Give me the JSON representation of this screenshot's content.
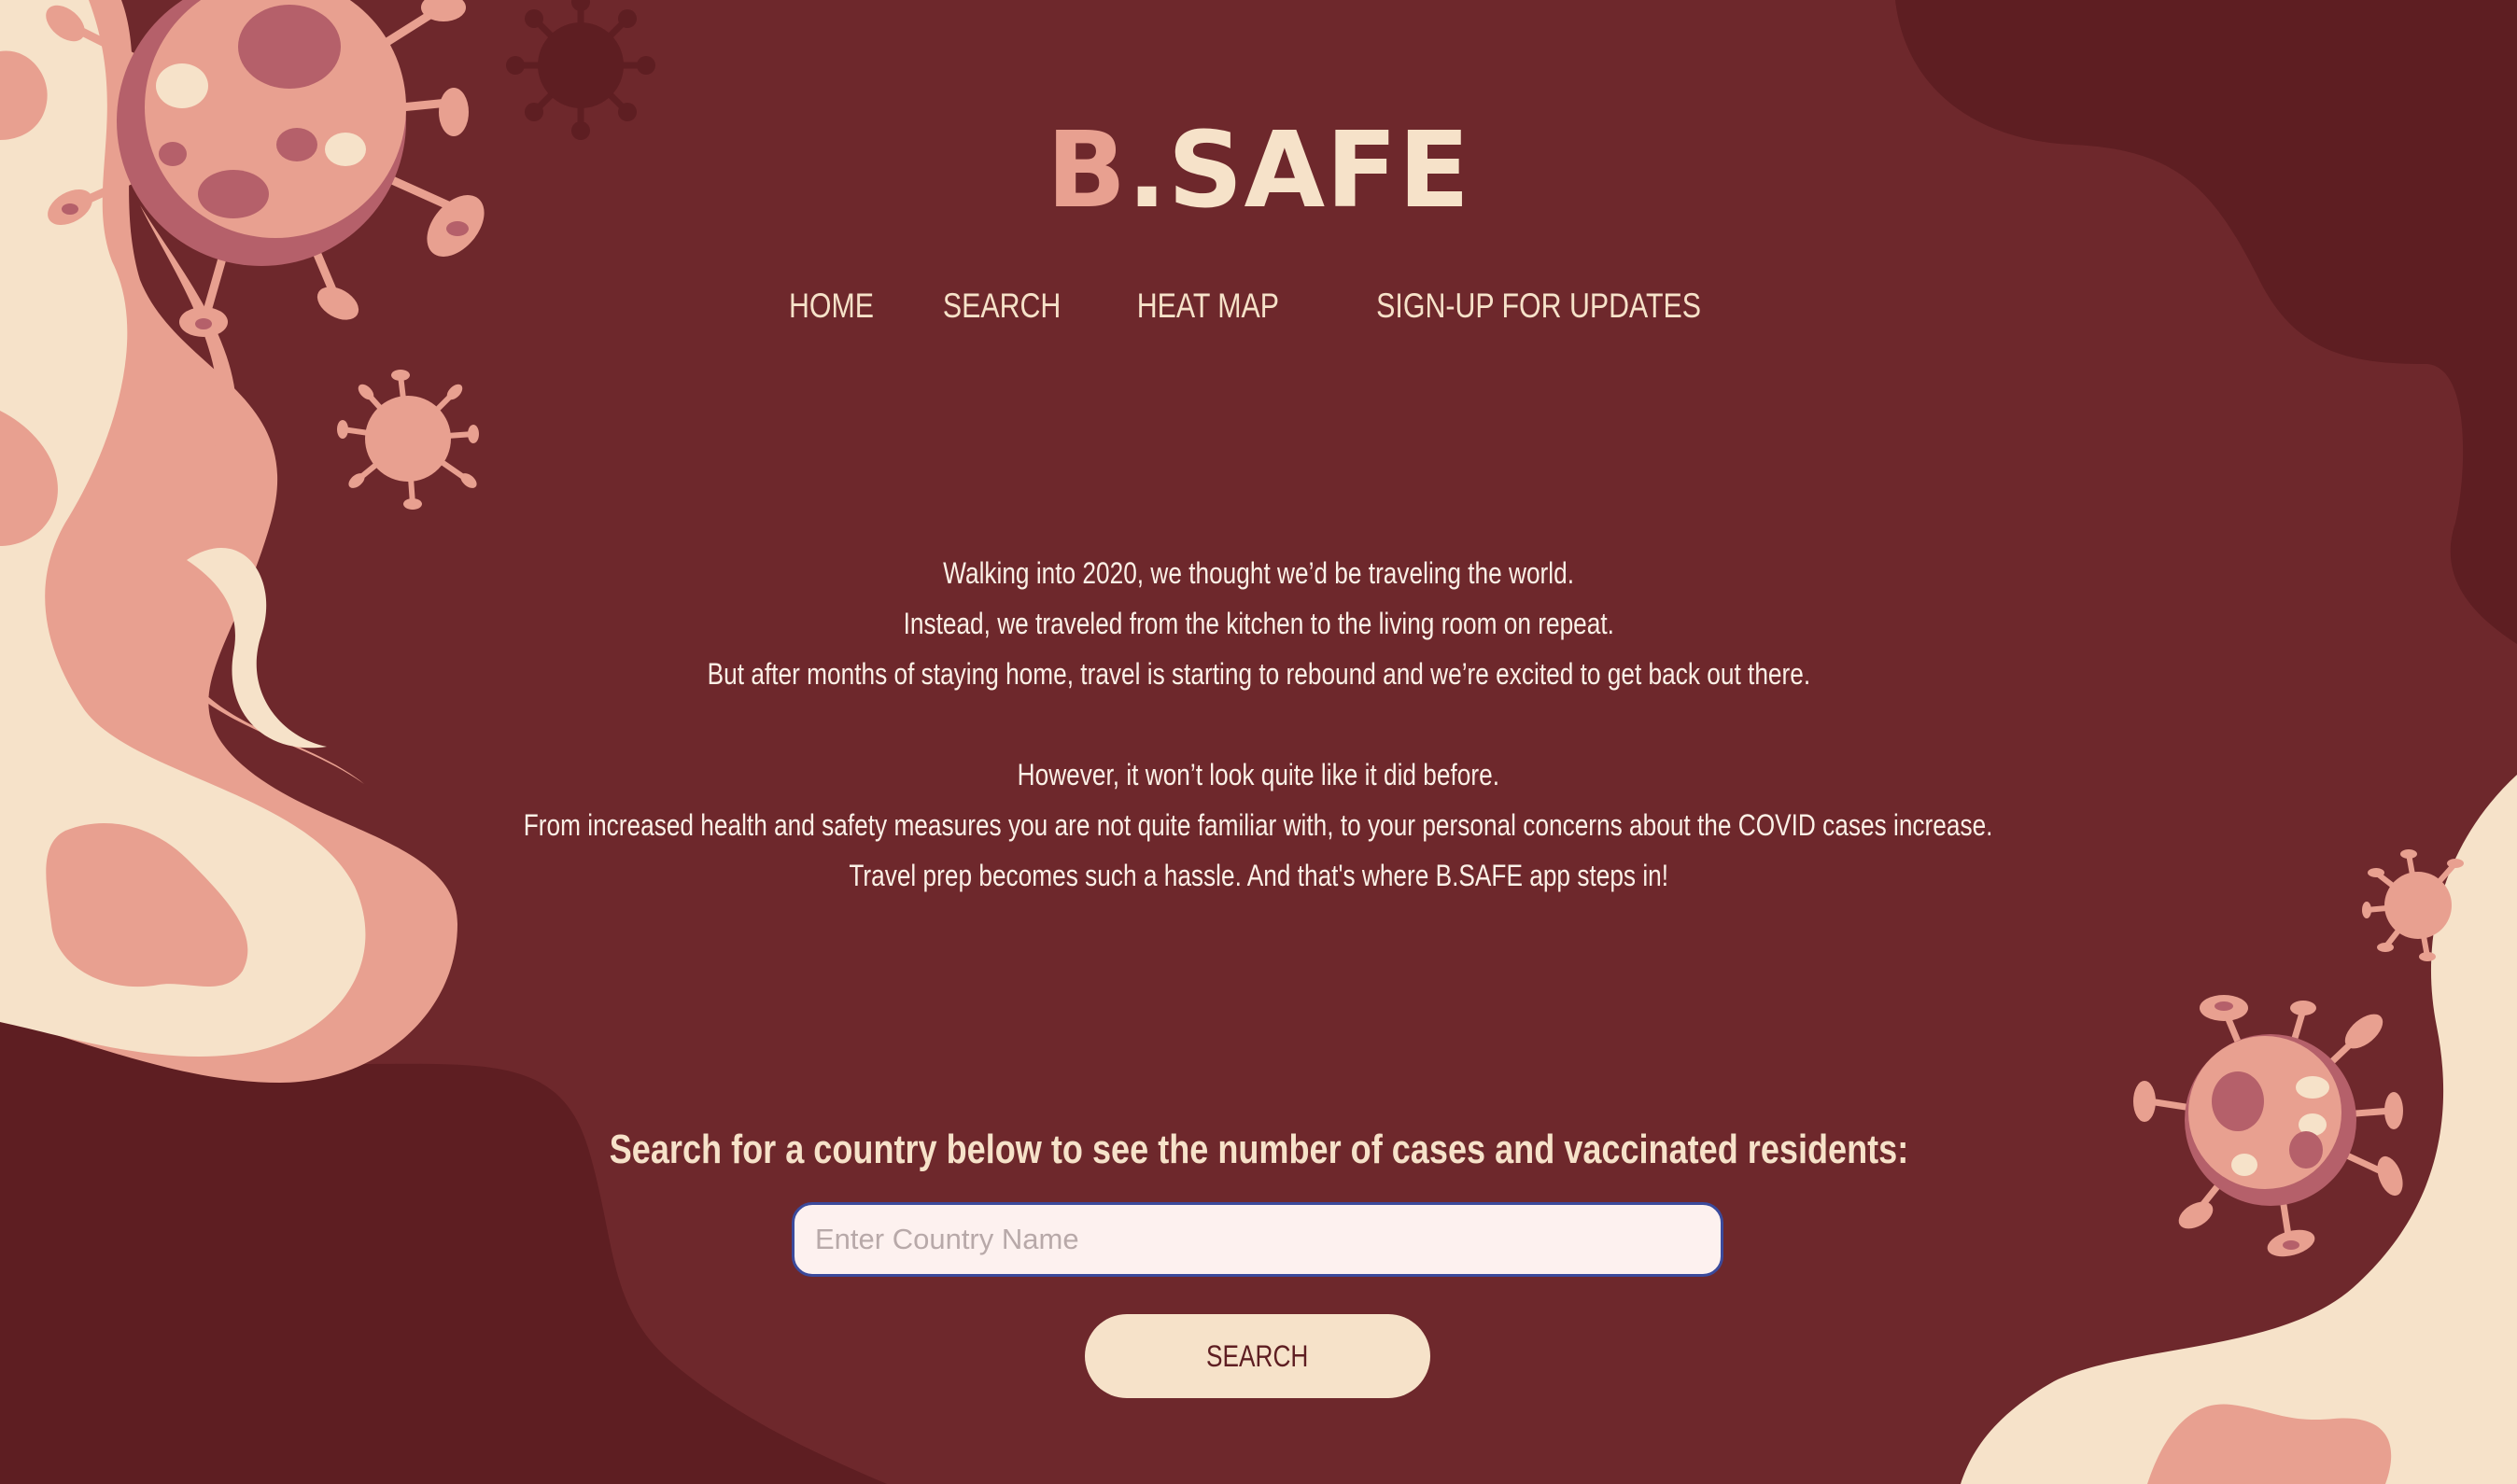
{
  "brand": {
    "logo_part1": "B",
    "logo_part2": ".",
    "logo_part3": "SAFE"
  },
  "nav": {
    "items": [
      {
        "label": "HOME"
      },
      {
        "label": "SEARCH"
      },
      {
        "label": "HEAT MAP"
      },
      {
        "label": "SIGN-UP FOR UPDATES"
      }
    ]
  },
  "intro": {
    "paragraph1": [
      "Walking into 2020, we thought we’d be traveling the world.",
      "Instead, we traveled from the kitchen to the living room on repeat.",
      "But after months of staying home, travel is starting to rebound and we’re excited to get back out there."
    ],
    "paragraph2": [
      "However, it won’t look quite like it did before.",
      "From increased health and safety measures you are not quite familiar with, to your personal concerns about the COVID cases increase.",
      "Travel prep becomes such a hassle. And that's where B.SAFE app steps in!"
    ]
  },
  "search": {
    "prompt": "Search for a country below to see the number of cases and vaccinated residents:",
    "placeholder": "Enter Country Name",
    "value": "",
    "button_label": "SEARCH"
  },
  "colors": {
    "background": "#6E282C",
    "dark_blob": "#5E1E22",
    "cream": "#F6E2C9",
    "salmon": "#E8A090",
    "virus_dark": "#B5606A",
    "input_border": "#3B4A9C"
  },
  "icons": [
    "virus-icon"
  ]
}
